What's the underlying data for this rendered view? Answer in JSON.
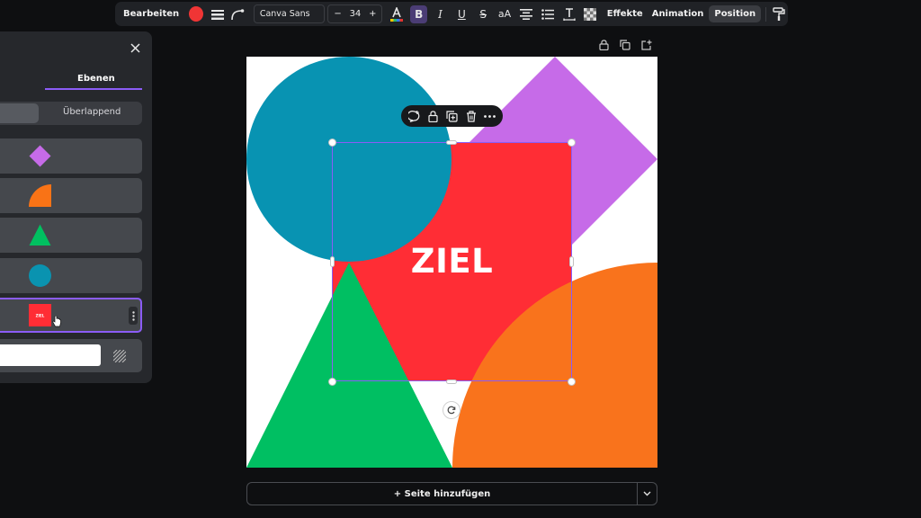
{
  "toolbar": {
    "edit_label": "Bearbeiten",
    "text_color": "#f03535",
    "font_name": "Canva Sans",
    "font_size": "34",
    "minus": "−",
    "plus": "+",
    "bold": "B",
    "italic": "I",
    "underline": "U",
    "strike": "S",
    "case": "aA",
    "effects_label": "Effekte",
    "animation_label": "Animation",
    "position_label": "Position"
  },
  "layers_panel": {
    "tab_partial": "en",
    "tab_active": "Ebenen",
    "segment_right": "Überlappend",
    "layers": [
      {
        "name": "diamond",
        "color": "#c66be8"
      },
      {
        "name": "quarter-circle",
        "color": "#f97316"
      },
      {
        "name": "triangle",
        "color": "#00c060"
      },
      {
        "name": "circle",
        "color": "#0a93b0"
      },
      {
        "name": "text-square",
        "color": "#ff2d35",
        "thumb_text": "ZIEL"
      }
    ],
    "background_color": "#ffffff"
  },
  "canvas": {
    "headline": "ZIEL",
    "colors": {
      "circle": "#0893b2",
      "diamond": "#c66be8",
      "square": "#ff2d35",
      "triangle": "#00bf62",
      "quarter": "#f9731c",
      "selection": "#8b5cf6"
    }
  },
  "footer": {
    "add_page_label": "+ Seite hinzufügen"
  }
}
